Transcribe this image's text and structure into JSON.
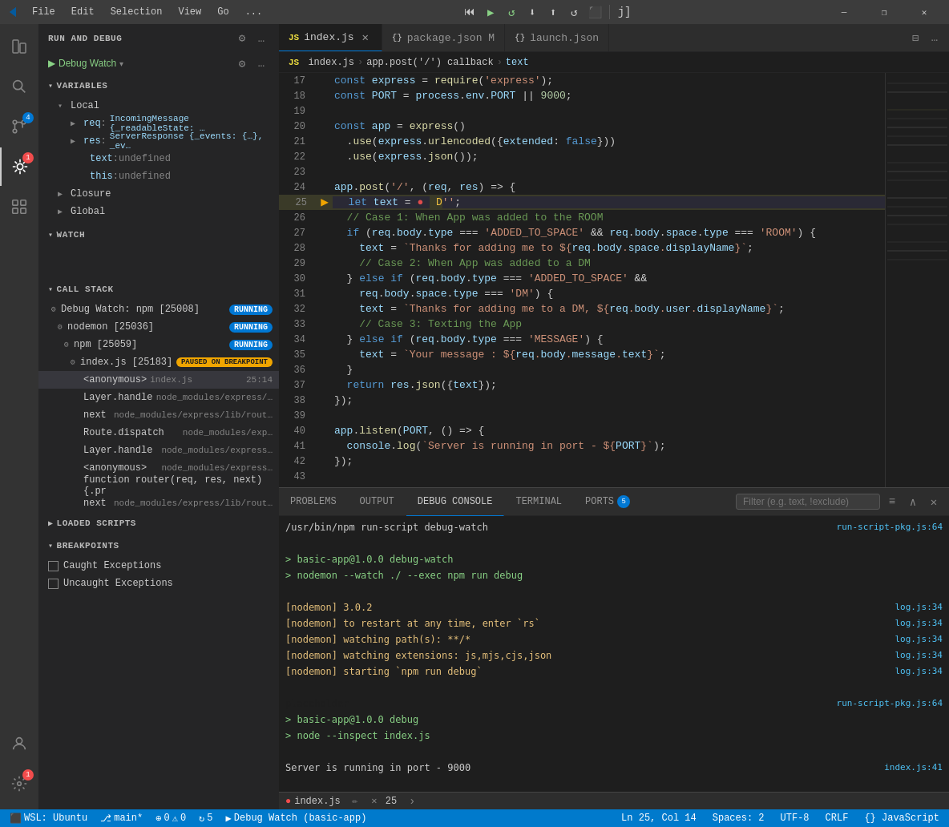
{
  "titlebar": {
    "icon": "⬡",
    "menus": [
      "File",
      "Edit",
      "Selection",
      "View",
      "Go",
      "..."
    ],
    "debug_controls": [
      "⏮",
      "▶",
      "↻",
      "⬇",
      "⬆",
      "↺",
      "⬛"
    ],
    "search_placeholder": "",
    "filename_badge": "j]",
    "window_buttons": [
      "—",
      "❐",
      "✕"
    ]
  },
  "activity_bar": {
    "items": [
      {
        "icon": "⎘",
        "name": "explorer",
        "active": false
      },
      {
        "icon": "🔍",
        "name": "search",
        "active": false
      },
      {
        "icon": "⎇",
        "name": "source-control",
        "badge": "4",
        "active": false
      },
      {
        "icon": "▶",
        "name": "run-debug",
        "badge": "1",
        "active": true
      },
      {
        "icon": "⊞",
        "name": "extensions",
        "active": false
      }
    ],
    "bottom_items": [
      {
        "icon": "⚙",
        "name": "settings",
        "badge": "1"
      },
      {
        "icon": "👤",
        "name": "account"
      }
    ]
  },
  "sidebar": {
    "title": "RUN AND DEBUG",
    "debug_config": {
      "play_icon": "▶",
      "config_name": "Debug Watch",
      "gear_icon": "⚙",
      "more_icon": "…"
    },
    "sections": {
      "variables": {
        "title": "VARIABLES",
        "expanded": true,
        "groups": {
          "local": {
            "title": "Local",
            "expanded": true,
            "items": [
              {
                "name": "req",
                "value": "IncomingMessage {_readableState: …"
              },
              {
                "name": "res",
                "value": "ServerResponse {_events: {…}, _ev…"
              },
              {
                "name": "text",
                "value": "undefined",
                "indent": 2
              },
              {
                "name": "this",
                "value": "undefined",
                "indent": 2
              }
            ]
          },
          "closure": {
            "title": "Closure",
            "expanded": false
          },
          "global": {
            "title": "Global",
            "expanded": false
          }
        }
      },
      "watch": {
        "title": "WATCH",
        "expanded": true
      },
      "call_stack": {
        "title": "CALL STACK",
        "expanded": true,
        "items": [
          {
            "name": "Debug Watch: npm [25008]",
            "status": "RUNNING",
            "indent": 0
          },
          {
            "name": "nodemon [25036]",
            "status": "RUNNING",
            "indent": 1
          },
          {
            "name": "npm [25059]",
            "status": "RUNNING",
            "indent": 2
          },
          {
            "name": "index.js [25183]",
            "status": "PAUSED ON BREAKPOINT",
            "indent": 3
          },
          {
            "name": "<anonymous>",
            "file": "index.js",
            "line": "25:14",
            "indent": 4,
            "active": true
          },
          {
            "name": "Layer.handle",
            "file": "node_modules/express/…",
            "indent": 4
          },
          {
            "name": "next",
            "file": "node_modules/express/lib/rout…",
            "indent": 4
          },
          {
            "name": "Route.dispatch",
            "file": "node_modules/exp…",
            "indent": 4
          },
          {
            "name": "Layer.handle",
            "file": "node_modules/express…",
            "indent": 4
          },
          {
            "name": "<anonymous>",
            "file": "node_modules/express…",
            "indent": 4
          },
          {
            "name": "function router(req, res, next) {.pr",
            "indent": 4
          },
          {
            "name": "next",
            "file": "node_modules/express/lib/rout…",
            "indent": 4
          }
        ]
      },
      "loaded_scripts": {
        "title": "LOADED SCRIPTS",
        "expanded": false
      },
      "breakpoints": {
        "title": "BREAKPOINTS",
        "expanded": true,
        "items": [
          {
            "label": "Caught Exceptions",
            "checked": false
          },
          {
            "label": "Uncaught Exceptions",
            "checked": false
          }
        ]
      }
    }
  },
  "editor": {
    "tabs": [
      {
        "name": "index.js",
        "icon": "JS",
        "active": true,
        "has_close": true,
        "lang_color": "#f0e040"
      },
      {
        "name": "package.json",
        "icon": "{}",
        "active": false,
        "modified": true
      },
      {
        "name": "launch.json",
        "icon": "{}",
        "active": false
      }
    ],
    "breadcrumb": [
      "index.js",
      "app.post('/') callback",
      "text"
    ],
    "current_file": "index.js",
    "lines": [
      {
        "num": 17,
        "content": "const express = require('express');",
        "tokens": [
          {
            "t": "kw",
            "v": "const"
          },
          {
            "t": "op",
            "v": " express "
          },
          {
            "t": "op",
            "v": "="
          },
          {
            "t": "op",
            "v": " "
          },
          {
            "t": "fn",
            "v": "require"
          },
          {
            "t": "punc",
            "v": "("
          },
          {
            "t": "str",
            "v": "'express'"
          },
          {
            "t": "punc",
            "v": "});"
          }
        ]
      },
      {
        "num": 18,
        "content": "const PORT = process.env.PORT || 9000;"
      },
      {
        "num": 19,
        "content": ""
      },
      {
        "num": 20,
        "content": "const app = express()"
      },
      {
        "num": 21,
        "content": "  .use(express.urlencoded({extended: false}))"
      },
      {
        "num": 22,
        "content": "  .use(express.json());"
      },
      {
        "num": 23,
        "content": ""
      },
      {
        "num": 24,
        "content": "app.post('/', (req, res) => {"
      },
      {
        "num": 25,
        "content": "  let text = ● D'';",
        "is_active": true,
        "has_breakpoint": true,
        "has_arrow": true
      },
      {
        "num": 26,
        "content": "  // Case 1: When App was added to the ROOM"
      },
      {
        "num": 27,
        "content": "  if (req.body.type === 'ADDED_TO_SPACE' && req.body.space.type === 'ROOM') {"
      },
      {
        "num": 28,
        "content": "    text = `Thanks for adding me to ${req.body.space.displayName}`;"
      },
      {
        "num": 29,
        "content": "    // Case 2: When App was added to a DM"
      },
      {
        "num": 30,
        "content": "  } else if (req.body.type === 'ADDED_TO_SPACE' &&"
      },
      {
        "num": 31,
        "content": "    req.body.space.type === 'DM') {"
      },
      {
        "num": 32,
        "content": "    text = `Thanks for adding me to a DM, ${req.body.user.displayName}`;"
      },
      {
        "num": 33,
        "content": "    // Case 3: Texting the App"
      },
      {
        "num": 34,
        "content": "  } else if (req.body.type === 'MESSAGE') {"
      },
      {
        "num": 35,
        "content": "    text = `Your message : ${req.body.message.text}`;"
      },
      {
        "num": 36,
        "content": "  }"
      },
      {
        "num": 37,
        "content": "  return res.json({text});"
      },
      {
        "num": 38,
        "content": "});"
      },
      {
        "num": 39,
        "content": ""
      },
      {
        "num": 40,
        "content": "app.listen(PORT, () => {"
      },
      {
        "num": 41,
        "content": "  console.log(`Server is running in port - ${PORT}`);"
      },
      {
        "num": 42,
        "content": "});"
      },
      {
        "num": 43,
        "content": ""
      }
    ]
  },
  "bottom_panel": {
    "tabs": [
      {
        "label": "PROBLEMS",
        "active": false
      },
      {
        "label": "OUTPUT",
        "active": false
      },
      {
        "label": "DEBUG CONSOLE",
        "active": true
      },
      {
        "label": "TERMINAL",
        "active": false
      },
      {
        "label": "PORTS",
        "active": false,
        "badge": "5"
      }
    ],
    "filter_placeholder": "Filter (e.g. text, !exclude)",
    "console_lines": [
      {
        "type": "cmd",
        "text": "/usr/bin/npm run-script debug-watch",
        "link": "run-script-pkg.js:64"
      },
      {
        "type": "blank"
      },
      {
        "type": "green",
        "text": "> basic-app@1.0.0 debug-watch"
      },
      {
        "type": "green",
        "text": "> nodemon --watch ./ --exec npm run debug"
      },
      {
        "type": "blank"
      },
      {
        "type": "info",
        "text": "[nodemon] 3.0.2",
        "link": "log.js:34"
      },
      {
        "type": "info",
        "text": "[nodemon] to restart at any time, enter `rs`",
        "link": "log.js:34"
      },
      {
        "type": "info",
        "text": "[nodemon] watching path(s): **/*",
        "link": "log.js:34"
      },
      {
        "type": "info",
        "text": "[nodemon] watching extensions: js,mjs,cjs,json",
        "link": "log.js:34"
      },
      {
        "type": "info",
        "text": "[nodemon] starting `npm run debug`",
        "link": "log.js:34"
      },
      {
        "type": "blank"
      },
      {
        "type": "info",
        "text": "run-script-pkg.js:64",
        "link": "run-script-pkg.js:64",
        "right_link": true
      },
      {
        "type": "green",
        "text": "> basic-app@1.0.0 debug"
      },
      {
        "type": "green",
        "text": "> node --inspect index.js"
      },
      {
        "type": "blank"
      },
      {
        "type": "info",
        "text": "Server is running in port - 9000",
        "link": "index.js:41"
      }
    ]
  },
  "status_bar": {
    "left": [
      {
        "icon": "⬛",
        "text": "WSL: Ubuntu"
      },
      {
        "icon": "⎇",
        "text": "main*"
      },
      {
        "icon": "⊕",
        "text": "0"
      },
      {
        "icon": "⚠",
        "text": "0"
      },
      {
        "icon": "↻",
        "text": "5"
      },
      {
        "icon": "▶",
        "text": "Debug Watch (basic-app)"
      }
    ],
    "right": [
      {
        "text": "Ln 25, Col 14"
      },
      {
        "text": "Spaces: 2"
      },
      {
        "text": "UTF-8"
      },
      {
        "text": "CRLF"
      },
      {
        "text": "{} JavaScript"
      }
    ],
    "file_indicator": "● index.js",
    "file_badge": "25"
  }
}
